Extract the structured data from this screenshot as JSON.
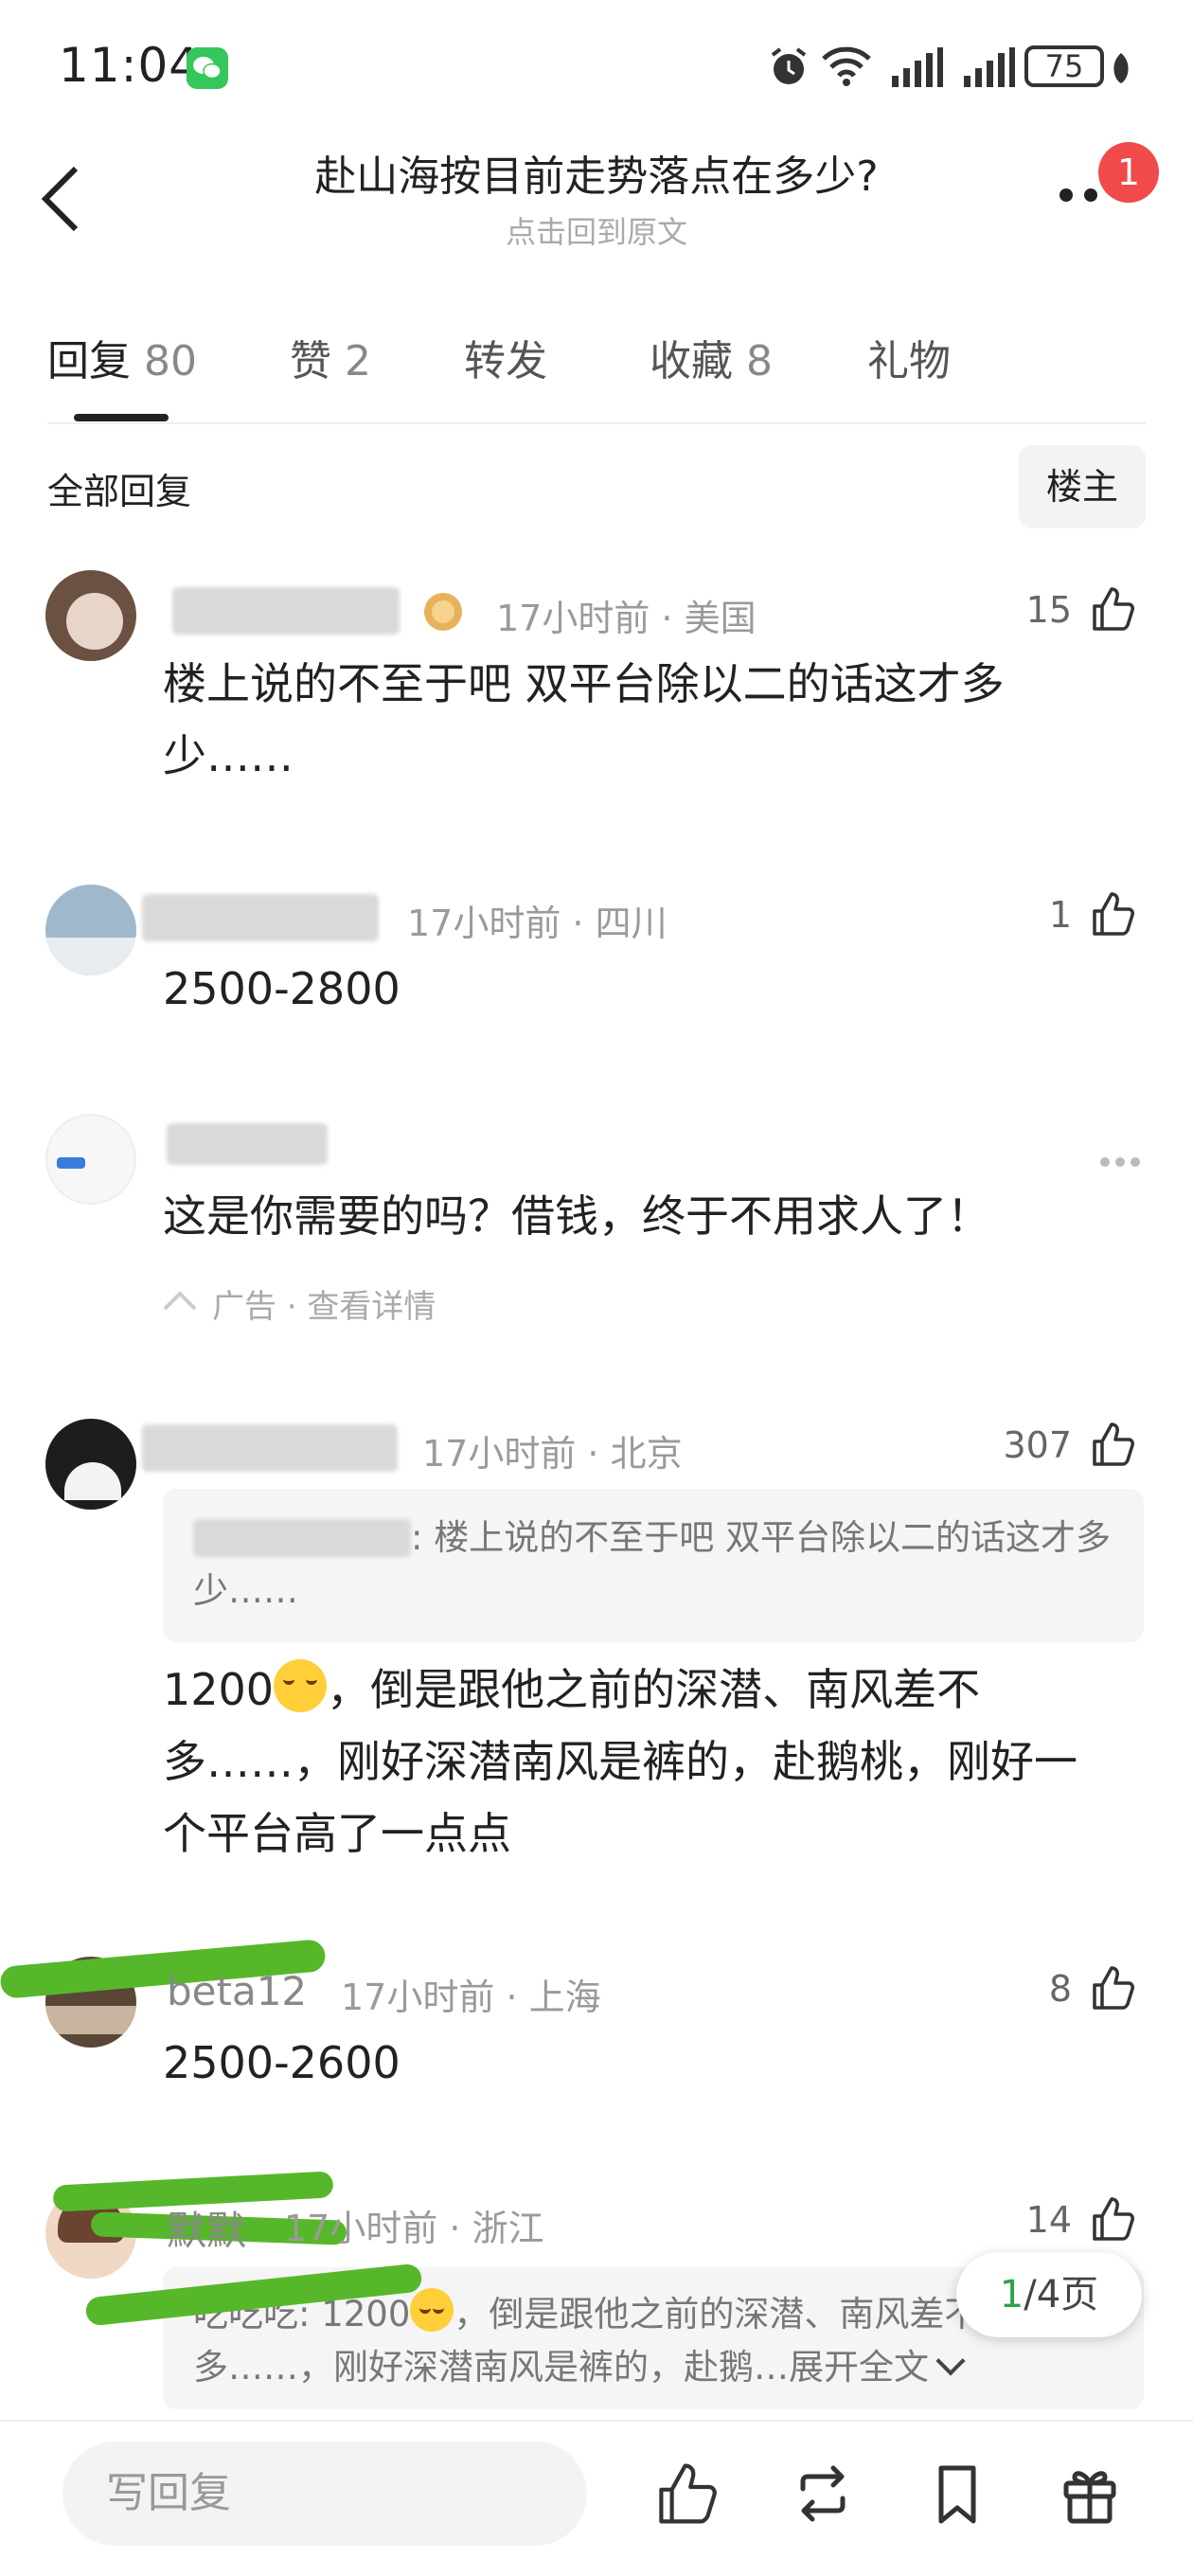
{
  "status": {
    "time": "11:04",
    "battery": "75"
  },
  "header": {
    "title": "赴山海按目前走势落点在多少?",
    "subtitle": "点击回到原文",
    "notification_count": "1"
  },
  "tabs": [
    {
      "label": "回复",
      "count": "80"
    },
    {
      "label": "赞",
      "count": "2"
    },
    {
      "label": "转发",
      "count": ""
    },
    {
      "label": "收藏",
      "count": "8"
    },
    {
      "label": "礼物",
      "count": ""
    }
  ],
  "section": {
    "label": "全部回复",
    "filter": "楼主"
  },
  "comments": [
    {
      "user": "",
      "meta": "17小时前 · 美国",
      "likes": "15",
      "text": "楼上说的不至于吧 双平台除以二的话这才多少……"
    },
    {
      "user": "",
      "meta": "17小时前 · 四川",
      "likes": "1",
      "text": "2500-2800"
    },
    {
      "user": "",
      "meta": "17小时前 · 北京",
      "likes": "307",
      "quote": ": 楼上说的不至于吧 双平台除以二的话这才多少……",
      "text_a": "1200",
      "text_b": "，倒是跟他之前的深潜、南风差不多……，刚好深潜南风是裤的，赴鹅桃，刚好一个平台高了一点点"
    },
    {
      "user": "beta12",
      "meta": "17小时前 · 上海",
      "likes": "8",
      "text": "2500-2600"
    },
    {
      "user": "默默",
      "meta": "17小时前 · 浙江",
      "likes": "14",
      "quote_a": "吃吃吃: 1200",
      "quote_b": "，倒是跟他之前的深潜、南风差不多……，刚好深潜南风是裤的，赴鹅…展开全文"
    }
  ],
  "ad": {
    "text": "这是你需要的吗？借钱，终于不用求人了！",
    "label": "广告 · 查看详情"
  },
  "pager": {
    "current": "1",
    "total": "/4页"
  },
  "bottom": {
    "reply_placeholder": "写回复"
  },
  "icons": {
    "like": "thumbs-up-icon",
    "repost": "repost-icon",
    "bookmark": "bookmark-icon",
    "gift": "gift-icon",
    "back": "back-arrow-icon",
    "more": "more-icon"
  },
  "colors": {
    "accent_green": "#2aa44a",
    "badge_red": "#f04a4a",
    "wechat_green": "#34c75a"
  }
}
